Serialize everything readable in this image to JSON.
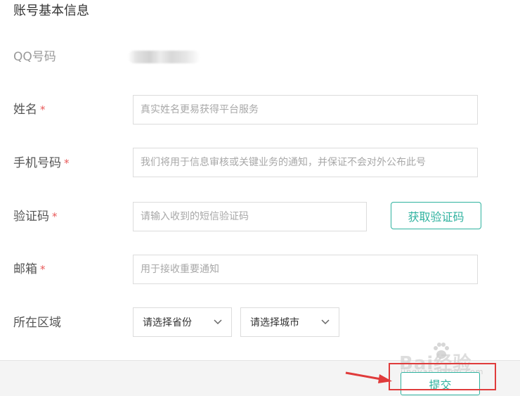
{
  "section": {
    "title": "账号基本信息"
  },
  "qq": {
    "label": "QQ号码"
  },
  "name": {
    "label": "姓名",
    "required": "*",
    "placeholder": "真实姓名更易获得平台服务"
  },
  "phone": {
    "label": "手机号码",
    "required": "*",
    "placeholder": "我们将用于信息审核或关键业务的通知，并保证不会对外公布此号"
  },
  "code": {
    "label": "验证码",
    "required": "*",
    "placeholder": "请输入收到的短信验证码",
    "button": "获取验证码"
  },
  "email": {
    "label": "邮箱",
    "required": "*",
    "placeholder": "用于接收重要通知"
  },
  "region": {
    "label": "所在区域",
    "province": "请选择省份",
    "city": "请选择城市"
  },
  "footer": {
    "submit": "提交"
  },
  "watermark": {
    "text": "Bai经验",
    "sub": "jingyan.baidu.com"
  },
  "colors": {
    "accent": "#2fb29f",
    "required": "#e85a5a",
    "highlight": "#e03b3b"
  }
}
